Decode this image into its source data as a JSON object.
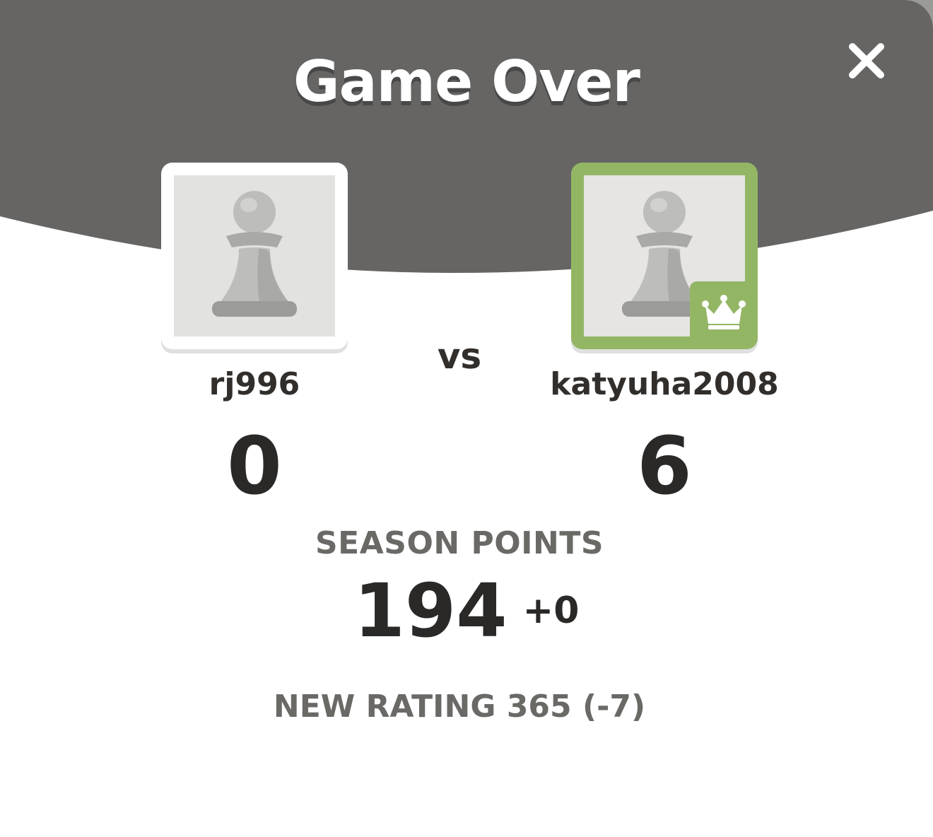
{
  "header": {
    "title": "Game Over",
    "close_label": "close"
  },
  "player": {
    "username": "rj996",
    "score": "0",
    "avatar_icon": "pawn-icon"
  },
  "opponent": {
    "username": "katyuha2008",
    "score": "6",
    "avatar_icon": "pawn-icon",
    "winner_badge_icon": "crown-icon"
  },
  "vs_label": "vs",
  "season": {
    "label": "SEASON POINTS",
    "value": "194",
    "delta": "+0"
  },
  "rating": {
    "text": "NEW RATING 365 (-7)"
  },
  "colors": {
    "header_bg": "#666564",
    "winner_green": "#93b665",
    "text_dark": "#312e2b",
    "text_muted": "#6b6966"
  }
}
